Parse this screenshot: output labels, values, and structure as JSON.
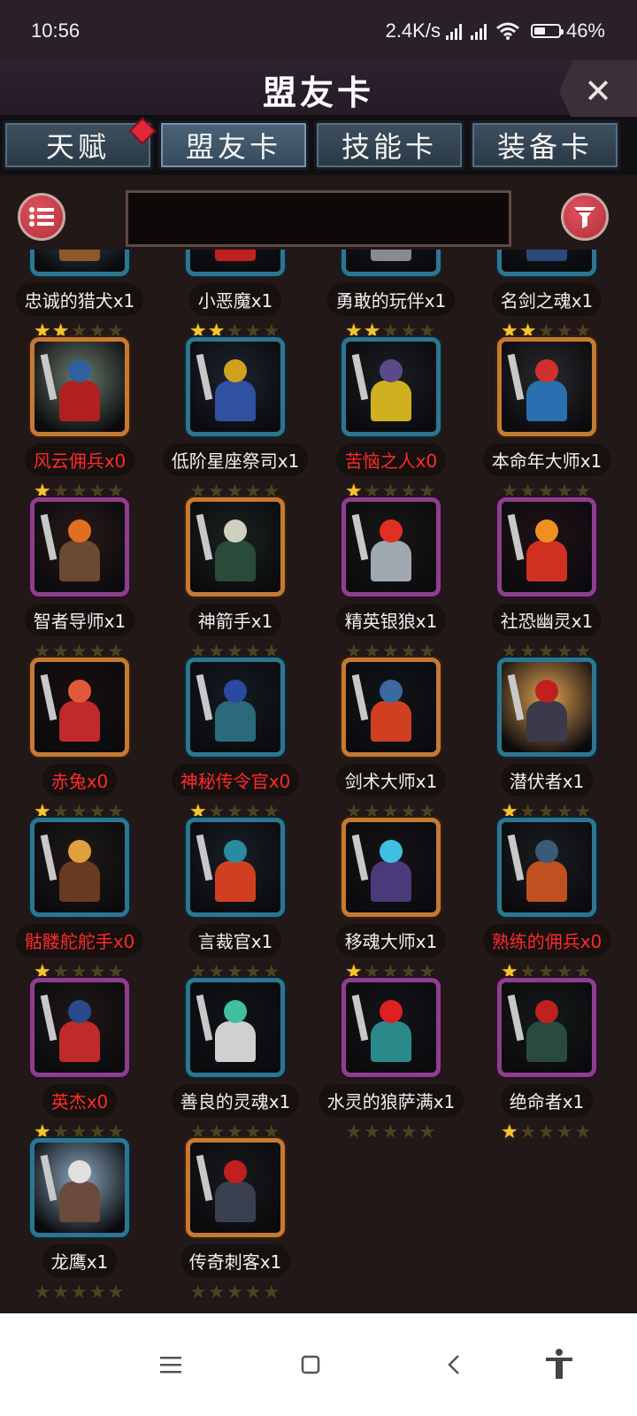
{
  "status_bar": {
    "time": "10:56",
    "network_speed": "2.4K/s",
    "battery": "46%",
    "battery_level": 0.46
  },
  "header": {
    "title": "盟友卡",
    "close_icon": "close-icon"
  },
  "tabs": [
    {
      "label": "天赋",
      "active": false,
      "has_badge": true
    },
    {
      "label": "盟友卡",
      "active": true,
      "has_badge": false
    },
    {
      "label": "技能卡",
      "active": false,
      "has_badge": false
    },
    {
      "label": "装备卡",
      "active": false,
      "has_badge": false
    }
  ],
  "toolbar": {
    "menu_icon": "list-icon",
    "filter_icon": "filter-icon",
    "search_value": ""
  },
  "cards": [
    {
      "name": "忠诚的猎犬x1",
      "owned": true,
      "stars": 2,
      "frame": "blue",
      "bg": "#3a5a6a",
      "c1": "#8a5a2a",
      "c2": "#e8e0d0"
    },
    {
      "name": "小恶魔x1",
      "owned": true,
      "stars": 2,
      "frame": "blue",
      "bg": "#1a1a22",
      "c1": "#c02020",
      "c2": "#2aa070"
    },
    {
      "name": "勇敢的玩伴x1",
      "owned": true,
      "stars": 2,
      "frame": "blue",
      "bg": "#1d1d22",
      "c1": "#8a8a90",
      "c2": "#e05020"
    },
    {
      "name": "名剑之魂x1",
      "owned": true,
      "stars": 2,
      "frame": "blue",
      "bg": "#14202a",
      "c1": "#2a4a7a",
      "c2": "#c03030"
    },
    {
      "name": "风云佣兵x0",
      "owned": false,
      "stars": 1,
      "frame": "orange",
      "bg": "#6a7a6a",
      "c1": "#b02020",
      "c2": "#3060a0"
    },
    {
      "name": "低阶星座祭司x1",
      "owned": true,
      "stars": 0,
      "frame": "blue",
      "bg": "#1c2430",
      "c1": "#3050a0",
      "c2": "#d0a020"
    },
    {
      "name": "苦恼之人x0",
      "owned": false,
      "stars": 1,
      "frame": "blue",
      "bg": "#1a1e22",
      "c1": "#d0b020",
      "c2": "#5a4a8a"
    },
    {
      "name": "本命年大师x1",
      "owned": true,
      "stars": 0,
      "frame": "orange",
      "bg": "#2a2a2e",
      "c1": "#2a70b0",
      "c2": "#d03030"
    },
    {
      "name": "智者导师x1",
      "owned": true,
      "stars": 0,
      "frame": "purple",
      "bg": "#2a1a18",
      "c1": "#6a4a30",
      "c2": "#e07020"
    },
    {
      "name": "神箭手x1",
      "owned": true,
      "stars": 0,
      "frame": "orange",
      "bg": "#1a2220",
      "c1": "#2a4a3a",
      "c2": "#d0d0c0"
    },
    {
      "name": "精英银狼x1",
      "owned": true,
      "stars": 0,
      "frame": "purple",
      "bg": "#181818",
      "c1": "#a0a8b0",
      "c2": "#e03020"
    },
    {
      "name": "社恐幽灵x1",
      "owned": true,
      "stars": 0,
      "frame": "purple",
      "bg": "#221218",
      "c1": "#d03020",
      "c2": "#f09020"
    },
    {
      "name": "赤兔x0",
      "owned": false,
      "stars": 1,
      "frame": "orange",
      "bg": "#1a0e0e",
      "c1": "#c02a2a",
      "c2": "#e05a3a"
    },
    {
      "name": "神秘传令官x0",
      "owned": false,
      "stars": 1,
      "frame": "blue",
      "bg": "#141c24",
      "c1": "#2a6a7a",
      "c2": "#2a4aa0"
    },
    {
      "name": "剑术大师x1",
      "owned": true,
      "stars": 0,
      "frame": "orange",
      "bg": "#101418",
      "c1": "#d04020",
      "c2": "#3a6aa0"
    },
    {
      "name": "潜伏者x1",
      "owned": true,
      "stars": 1,
      "frame": "blue",
      "bg": "#e0a050",
      "c1": "#3a3a4a",
      "c2": "#c02020"
    },
    {
      "name": "骷髅舵舵手x0",
      "owned": false,
      "stars": 1,
      "frame": "blue",
      "bg": "#201a18",
      "c1": "#6a3a20",
      "c2": "#e0a040"
    },
    {
      "name": "言裁官x1",
      "owned": true,
      "stars": 0,
      "frame": "blue",
      "bg": "#182028",
      "c1": "#d04020",
      "c2": "#2a8aa0"
    },
    {
      "name": "移魂大师x1",
      "owned": true,
      "stars": 1,
      "frame": "orange",
      "bg": "#141418",
      "c1": "#4a3a7a",
      "c2": "#40c0e0"
    },
    {
      "name": "熟练的佣兵x0",
      "owned": false,
      "stars": 1,
      "frame": "blue",
      "bg": "#1a1e20",
      "c1": "#c05020",
      "c2": "#3a5a7a"
    },
    {
      "name": "英杰x0",
      "owned": false,
      "stars": 1,
      "frame": "purple",
      "bg": "#201818",
      "c1": "#c02a2a",
      "c2": "#2a4a8a"
    },
    {
      "name": "善良的灵魂x1",
      "owned": true,
      "stars": 0,
      "frame": "blue",
      "bg": "#101418",
      "c1": "#d0d0d0",
      "c2": "#40c0a0"
    },
    {
      "name": "水灵的狼萨满x1",
      "owned": true,
      "stars": 0,
      "frame": "purple",
      "bg": "#14141a",
      "c1": "#2a8a8a",
      "c2": "#e02020"
    },
    {
      "name": "绝命者x1",
      "owned": true,
      "stars": 1,
      "frame": "purple",
      "bg": "#141a18",
      "c1": "#2a4a40",
      "c2": "#c02020"
    },
    {
      "name": "龙鹰x1",
      "owned": true,
      "stars": 0,
      "frame": "blue",
      "bg": "#8aa8c0",
      "c1": "#6a4a3a",
      "c2": "#e0e0e0"
    },
    {
      "name": "传奇刺客x1",
      "owned": true,
      "stars": 0,
      "frame": "orange",
      "bg": "#1a1a1e",
      "c1": "#3a4050",
      "c2": "#c02020"
    }
  ],
  "nav": {
    "menu_icon": "menu-icon",
    "home_icon": "home-icon",
    "back_icon": "back-icon",
    "accessibility_icon": "accessibility-icon"
  }
}
